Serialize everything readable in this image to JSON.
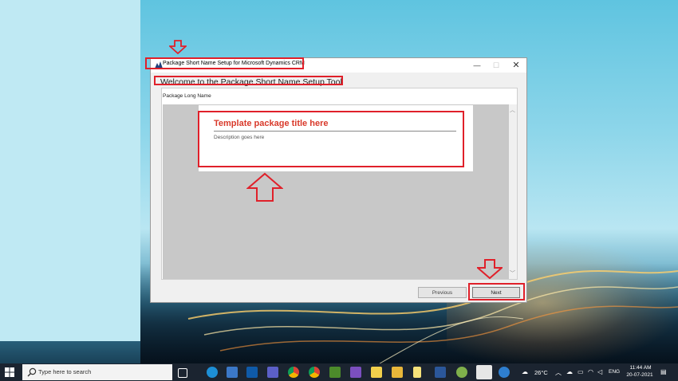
{
  "window": {
    "title": "Package Short Name Setup for Microsoft Dynamics CRM",
    "minimize_glyph": "—",
    "maximize_glyph": "☐",
    "close_glyph": "✕"
  },
  "main": {
    "heading": "Welcome to the Package Short Name Setup Tool",
    "long_name_label": "Package Long Name",
    "template": {
      "title": "Template package title here",
      "description": "Description goes here"
    }
  },
  "buttons": {
    "previous_label": "Previous",
    "next_label": "Next"
  },
  "taskbar": {
    "search_placeholder": "Type here to search",
    "temperature": "26°C",
    "language": "ENG",
    "time": "11:44 AM",
    "date": "20-07-2021",
    "apps": [
      "task-view-icon",
      "edge-icon",
      "store-icon",
      "outlook-icon",
      "teams-icon",
      "chrome-icon",
      "chrome-alt-icon",
      "minecraft-icon",
      "visual-studio-icon",
      "sticky-notes-icon",
      "file-explorer-icon",
      "notes-icon",
      "word-icon",
      "browser-icon",
      "dynamics-icon",
      "help-icon"
    ]
  },
  "colors": {
    "highlight": "#e0202a",
    "template_title": "#d93a2b",
    "taskbar": "#1b2430"
  }
}
